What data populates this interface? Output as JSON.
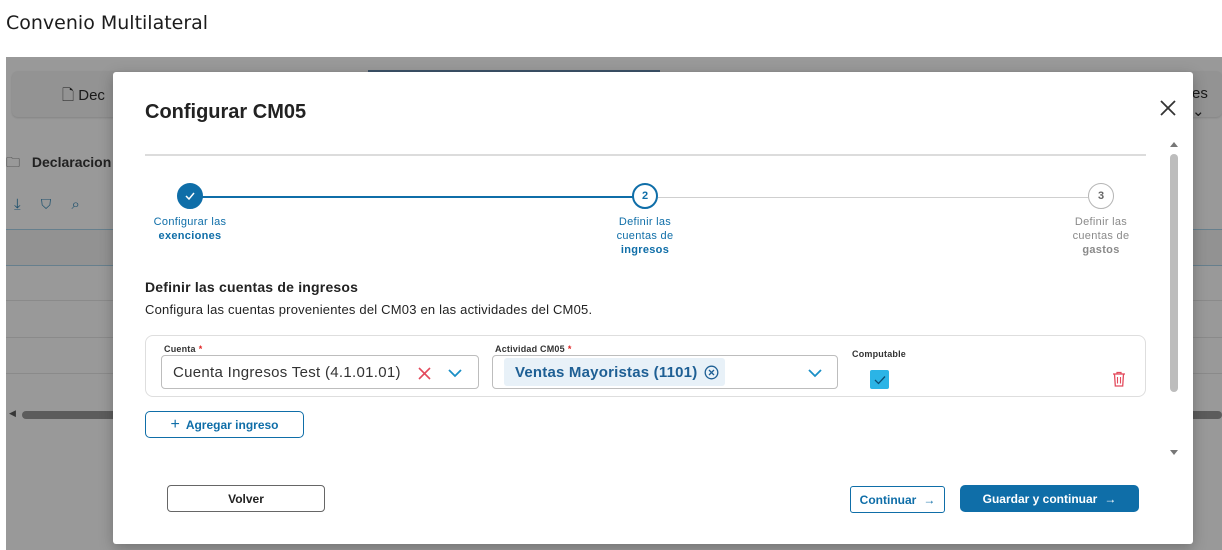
{
  "page": {
    "title": "Convenio Multilateral"
  },
  "background": {
    "tab_left": "Dec",
    "tab_right": "es",
    "folder_label": "Declaracion"
  },
  "modal": {
    "title": "Configurar CM05",
    "steps": [
      {
        "number": "✓",
        "line1": "Configurar las",
        "line2": "exenciones",
        "state": "done"
      },
      {
        "number": "2",
        "line1": "Definir las",
        "line1b": "cuentas de",
        "line2": "ingresos",
        "state": "active"
      },
      {
        "number": "3",
        "line1": "Definir las",
        "line1b": "cuentas de",
        "line2": "gastos",
        "state": "pending"
      }
    ],
    "section_title": "Definir las cuentas de ingresos",
    "section_desc": "Configura las cuentas provenientes del CM03 en las actividades del CM05.",
    "row": {
      "cuenta_label": "Cuenta",
      "cuenta_value": "Cuenta Ingresos Test (4.1.01.01)",
      "actividad_label": "Actividad CM05",
      "actividad_chip": "Ventas Mayoristas (1101)",
      "computable_label": "Computable",
      "computable_checked": true,
      "required_mark": "*"
    },
    "add_button": "Agregar ingreso",
    "buttons": {
      "volver": "Volver",
      "continuar": "Continuar",
      "guardar": "Guardar y continuar",
      "arrow": "→"
    }
  },
  "colors": {
    "primary": "#0f6ea8",
    "checkbox": "#2bb4e6",
    "danger": "#e34a5c",
    "chip_bg": "#e8f1f8"
  }
}
